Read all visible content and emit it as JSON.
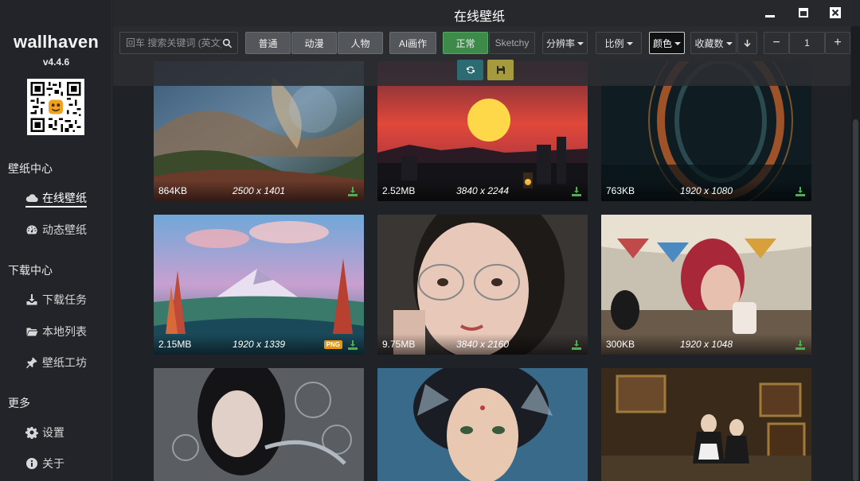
{
  "window": {
    "title": "在线壁纸"
  },
  "app": {
    "logo": "wallhaven",
    "version": "v4.4.6"
  },
  "sidebar": {
    "sections": [
      {
        "title": "壁纸中心",
        "items": [
          {
            "label": "在线壁纸",
            "icon": "cloud-icon",
            "active": true
          },
          {
            "label": "动态壁纸",
            "icon": "dashboard-icon"
          }
        ]
      },
      {
        "title": "下载中心",
        "items": [
          {
            "label": "下载任务",
            "icon": "download-icon"
          },
          {
            "label": "本地列表",
            "icon": "folder-icon"
          },
          {
            "label": "壁纸工坊",
            "icon": "pin-icon"
          }
        ]
      },
      {
        "title": "更多",
        "items": [
          {
            "label": "设置",
            "icon": "gear-icon"
          },
          {
            "label": "关于",
            "icon": "info-icon"
          }
        ]
      }
    ]
  },
  "toolbar": {
    "search_placeholder": "回车 搜索关键词 (英文)",
    "categories": [
      "普通",
      "动漫",
      "人物"
    ],
    "ai_label": "AI画作",
    "purity": [
      "正常",
      "Sketchy"
    ],
    "resolution_label": "分辨率",
    "ratio_label": "比例",
    "color_label": "颜色",
    "sort_label": "收藏数",
    "page_value": "1",
    "minus_label": "−",
    "plus_label": "+"
  },
  "wallpapers": [
    {
      "size": "864KB",
      "res": "2500 x 1401",
      "png": false
    },
    {
      "size": "2.52MB",
      "res": "3840 x 2244",
      "png": false
    },
    {
      "size": "763KB",
      "res": "1920 x 1080",
      "png": false
    },
    {
      "size": "2.15MB",
      "res": "1920 x 1339",
      "png": true,
      "badge": "PNG"
    },
    {
      "size": "9.75MB",
      "res": "3840 x 2160",
      "png": false
    },
    {
      "size": "300KB",
      "res": "1920 x 1048",
      "png": false
    },
    {
      "size": "",
      "res": "",
      "png": false
    },
    {
      "size": "",
      "res": "",
      "png": false
    },
    {
      "size": "",
      "res": "",
      "png": false
    }
  ],
  "colors": {
    "accent_green": "#3d8a4a",
    "download_green": "#4caf50",
    "refresh_teal": "#2d6b72",
    "save_olive": "#a69a3e",
    "png_orange": "#e8960a"
  }
}
